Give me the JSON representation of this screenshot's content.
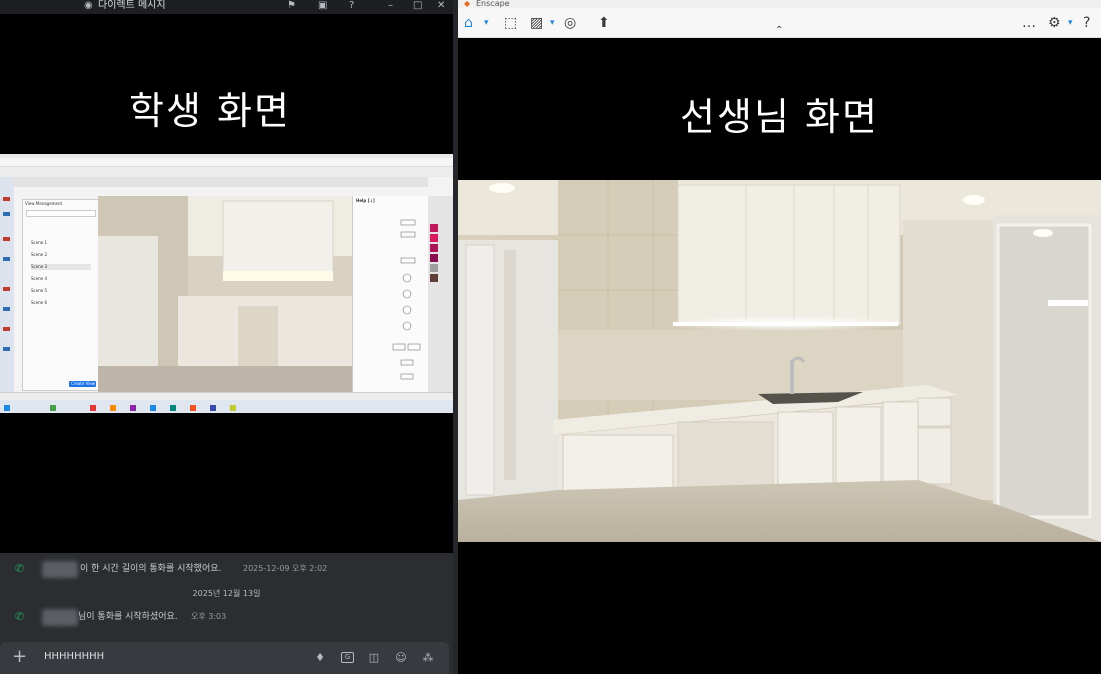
{
  "left_window": {
    "title": "다이렉트 메시지",
    "student_caption": "학생 화면",
    "shared_screen": {
      "view_panel_title": "View Management",
      "scenes": [
        "Scene 1",
        "Scene 2",
        "Scene 3",
        "Scene 4",
        "Scene 5",
        "Scene 6"
      ],
      "properties_title": "Help [↓]",
      "create_button": "Create View"
    },
    "chat": {
      "messages": [
        {
          "text": "이 한 시간 길이의 통화를 시작했어요.",
          "time": "2025-12-09 오후 2:02"
        },
        {
          "text": "님이 통화를 시작하셨어요.",
          "time": "오후 3:03"
        }
      ],
      "date_separator": "2025년 12월 13일"
    },
    "composer": {
      "value": "HHHHHHHH"
    }
  },
  "right_window": {
    "title": "Enscape",
    "teacher_caption": "선생님 화면"
  },
  "colors": {
    "discord_bg": "#2b2d31",
    "call_green": "#23a559",
    "accent_blue": "#1a73e8"
  }
}
